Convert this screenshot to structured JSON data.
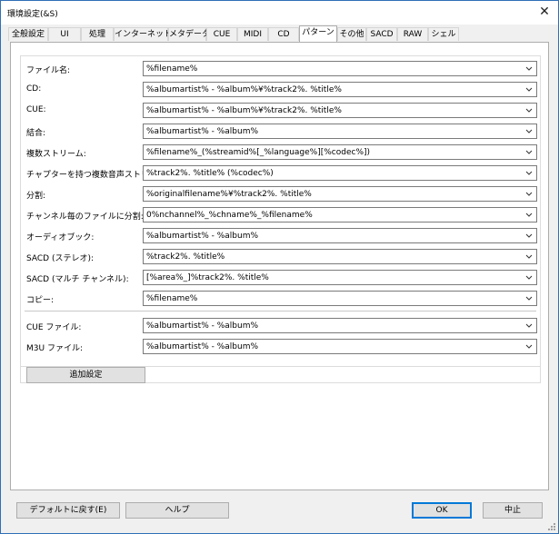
{
  "window": {
    "title": "環境設定(&S)",
    "close_glyph": "✕"
  },
  "tabs": [
    {
      "label": "全般設定",
      "active": false
    },
    {
      "label": "UI",
      "active": false
    },
    {
      "label": "処理",
      "active": false
    },
    {
      "label": "インターネット",
      "active": false
    },
    {
      "label": "メタデータ",
      "active": false
    },
    {
      "label": "CUE",
      "active": false
    },
    {
      "label": "MIDI",
      "active": false
    },
    {
      "label": "CD",
      "active": false
    },
    {
      "label": "パターン",
      "active": true
    },
    {
      "label": "その他",
      "active": false
    },
    {
      "label": "SACD",
      "active": false
    },
    {
      "label": "RAW",
      "active": false
    },
    {
      "label": "シェル",
      "active": false
    }
  ],
  "patterns": [
    {
      "label": "ファイル名:",
      "value": "%filename%"
    },
    {
      "label": "CD:",
      "value": "%albumartist% - %album%¥%track2%. %title%"
    },
    {
      "label": "CUE:",
      "value": "%albumartist% - %album%¥%track2%. %title%"
    },
    {
      "label": "結合:",
      "value": "%albumartist% - %album%"
    },
    {
      "label": "複数ストリーム:",
      "value": "%filename%_(%streamid%[_%language%][%codec%])"
    },
    {
      "label": "チャプターを持つ複数音声ストリーム:",
      "value": "%track2%. %title% (%codec%)"
    },
    {
      "label": "分割:",
      "value": "%originalfilename%¥%track2%. %title%"
    },
    {
      "label": "チャンネル毎のファイルに分割:",
      "value": "0%nchannel%_%chname%_%filename%"
    },
    {
      "label": "オーディオブック:",
      "value": "%albumartist% - %album%"
    },
    {
      "label": "SACD (ステレオ):",
      "value": "%track2%. %title%"
    },
    {
      "label": "SACD (マルチ チャンネル):",
      "value": "[%area%_]%track2%. %title%"
    },
    {
      "label": "コピー:",
      "value": "%filename%"
    }
  ],
  "list_files": [
    {
      "label": "CUE ファイル:",
      "value": "%albumartist% - %album%"
    },
    {
      "label": "M3U ファイル:",
      "value": "%albumartist% - %album%"
    }
  ],
  "buttons": {
    "additional_settings": "追加設定",
    "restore_defaults": "デフォルトに戻す(E)",
    "help": "ヘルプ",
    "ok": "OK",
    "cancel": "中止"
  },
  "icons": {
    "dropdown": "chevron-down-icon",
    "close": "close-icon",
    "resize": "resize-grip-icon"
  }
}
